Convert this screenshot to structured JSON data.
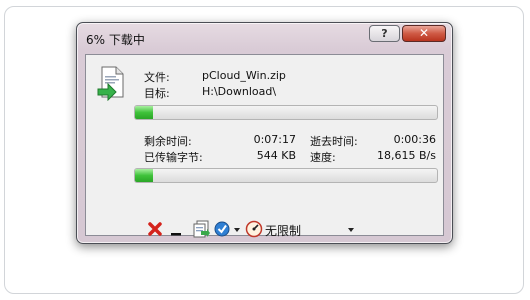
{
  "window": {
    "title": "6% 下载中",
    "help_label": "?",
    "close_label": "✕"
  },
  "file": {
    "name_label": "文件:",
    "name_value": "pCloud_Win.zip",
    "target_label": "目标:",
    "target_value": "H:\\Download\\"
  },
  "progress": {
    "file_fraction": 0.06,
    "overall_fraction": 0.06
  },
  "stats": {
    "remaining_label": "剩余时间:",
    "remaining_value": "0:07:17",
    "elapsed_label": "逝去时间:",
    "elapsed_value": "0:00:36",
    "transferred_label": "已传输字节:",
    "transferred_value": "544 KB",
    "speed_label": "速度:",
    "speed_value": "18,615 B/s"
  },
  "toolbar": {
    "cancel_icon": "red-x-icon",
    "minimize_icon": "minimize-icon",
    "copy_icon": "copy-icon",
    "schedule_icon": "check-clock-icon",
    "speed_icon": "speedometer-icon",
    "speed_limit_label": "无限制",
    "cancel_color": "#d4231c"
  }
}
